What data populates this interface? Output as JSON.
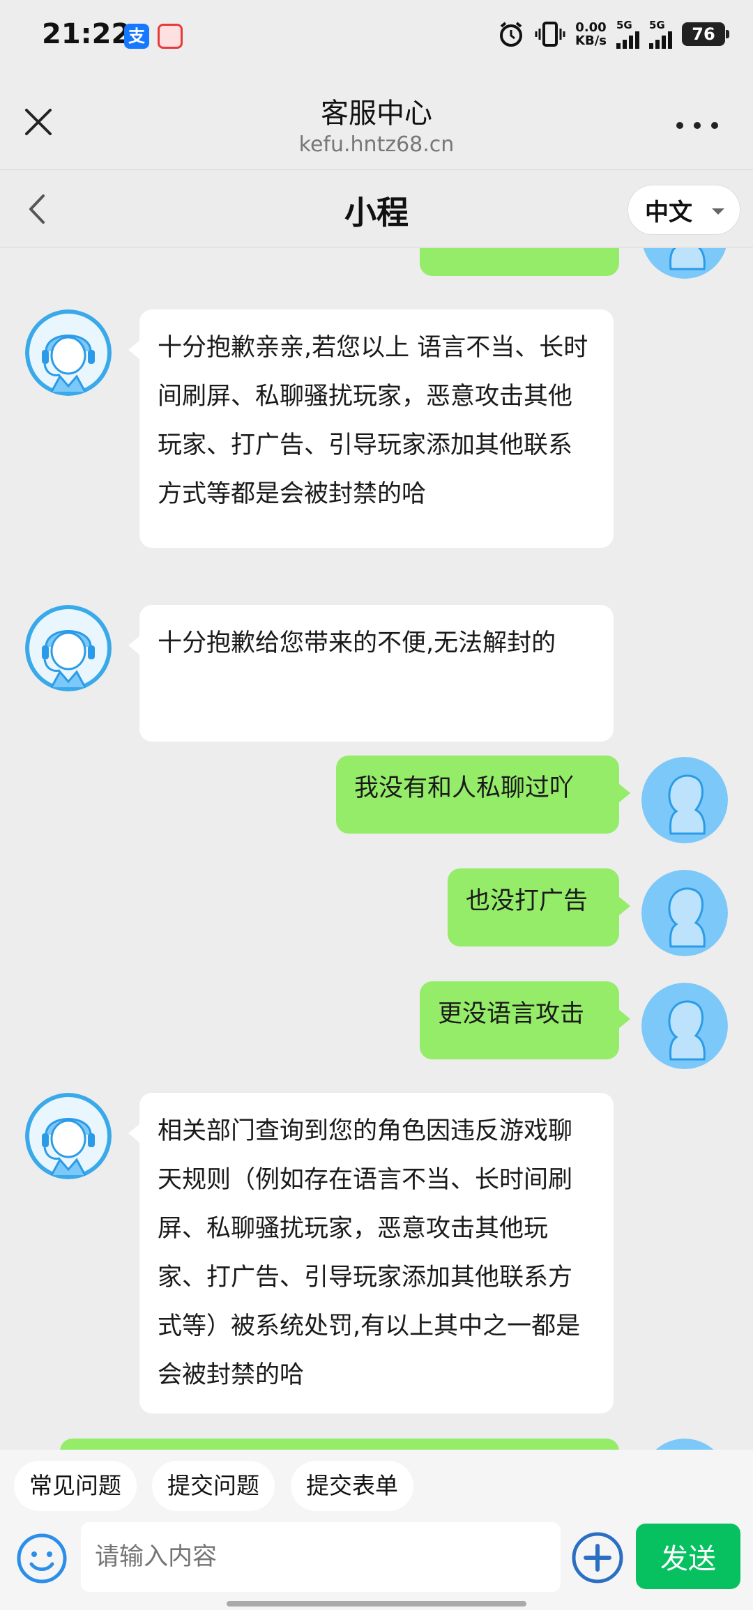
{
  "status_bar": {
    "time": "21:22",
    "net_speed_value": "0.00",
    "net_speed_unit": "KB/s",
    "sim1_label": "5G",
    "sim2_label": "5G",
    "battery": "76"
  },
  "webview": {
    "title": "客服中心",
    "url": "kefu.hntz68.cn"
  },
  "chat_header": {
    "title": "小程",
    "language": "中文"
  },
  "messages": [
    {
      "side": "left",
      "text": "十分抱歉亲亲,若您以上 语言不当、长时间刷屏、私聊骚扰玩家，恶意攻击其他玩家、打广告、引导玩家添加其他联系方式等都是会被封禁的哈"
    },
    {
      "side": "left",
      "text": "十分抱歉给您带来的不便,无法解封的"
    },
    {
      "side": "right",
      "text": "我没有和人私聊过吖"
    },
    {
      "side": "right",
      "text": "也没打广告"
    },
    {
      "side": "right",
      "text": "更没语言攻击"
    },
    {
      "side": "left",
      "text": "相关部门查询到您的角色因违反游戏聊天规则（例如存在语言不当、长时间刷屏、私聊骚扰玩家，恶意攻击其他玩家、打广告、引导玩家添加其他联系方式等）被系统处罚,有以上其中之一都是会被封禁的哈"
    }
  ],
  "quick_actions": [
    "常见问题",
    "提交问题",
    "提交表单"
  ],
  "composer": {
    "placeholder": "请输入内容",
    "send_label": "发送"
  },
  "colors": {
    "user_bubble": "#95ec69",
    "agent_bubble": "#ffffff",
    "send_button": "#07c160",
    "avatar_blue": "#3aa9ea"
  },
  "icons": [
    "alarm-icon",
    "vibrate-icon",
    "close-icon",
    "more-icon",
    "back-icon",
    "emoji-icon",
    "plus-icon"
  ]
}
